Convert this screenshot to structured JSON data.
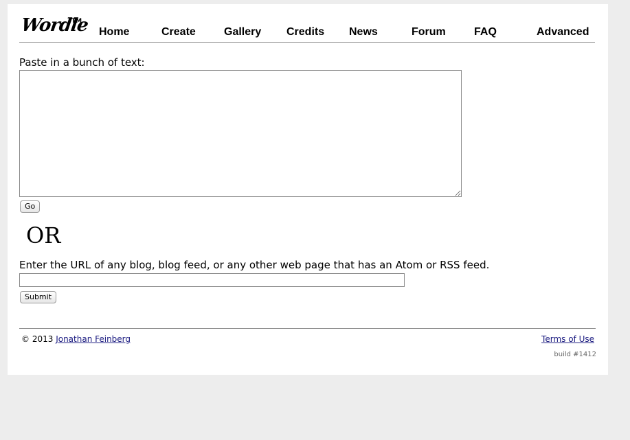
{
  "logo": {
    "text": "Wordle",
    "trademark": "TM"
  },
  "nav": {
    "items": [
      {
        "label": "Home"
      },
      {
        "label": "Create"
      },
      {
        "label": "Gallery"
      },
      {
        "label": "Credits"
      },
      {
        "label": "News"
      },
      {
        "label": "Forum"
      },
      {
        "label": "FAQ"
      },
      {
        "label": "Advanced"
      }
    ]
  },
  "text_form": {
    "label": "Paste in a bunch of text:",
    "value": "",
    "go_label": "Go"
  },
  "or_text": "OR",
  "url_form": {
    "label": "Enter the URL of any blog, blog feed, or any other web page that has an Atom or RSS feed.",
    "value": "",
    "submit_label": "Submit"
  },
  "footer": {
    "copyright": "© 2013",
    "author_link": "Jonathan Feinberg",
    "terms_link": "Terms of Use",
    "build": "build #1412"
  },
  "colors": {
    "page_background": "#ededed",
    "panel_background": "#ffffff",
    "link": "#1a1a80"
  }
}
